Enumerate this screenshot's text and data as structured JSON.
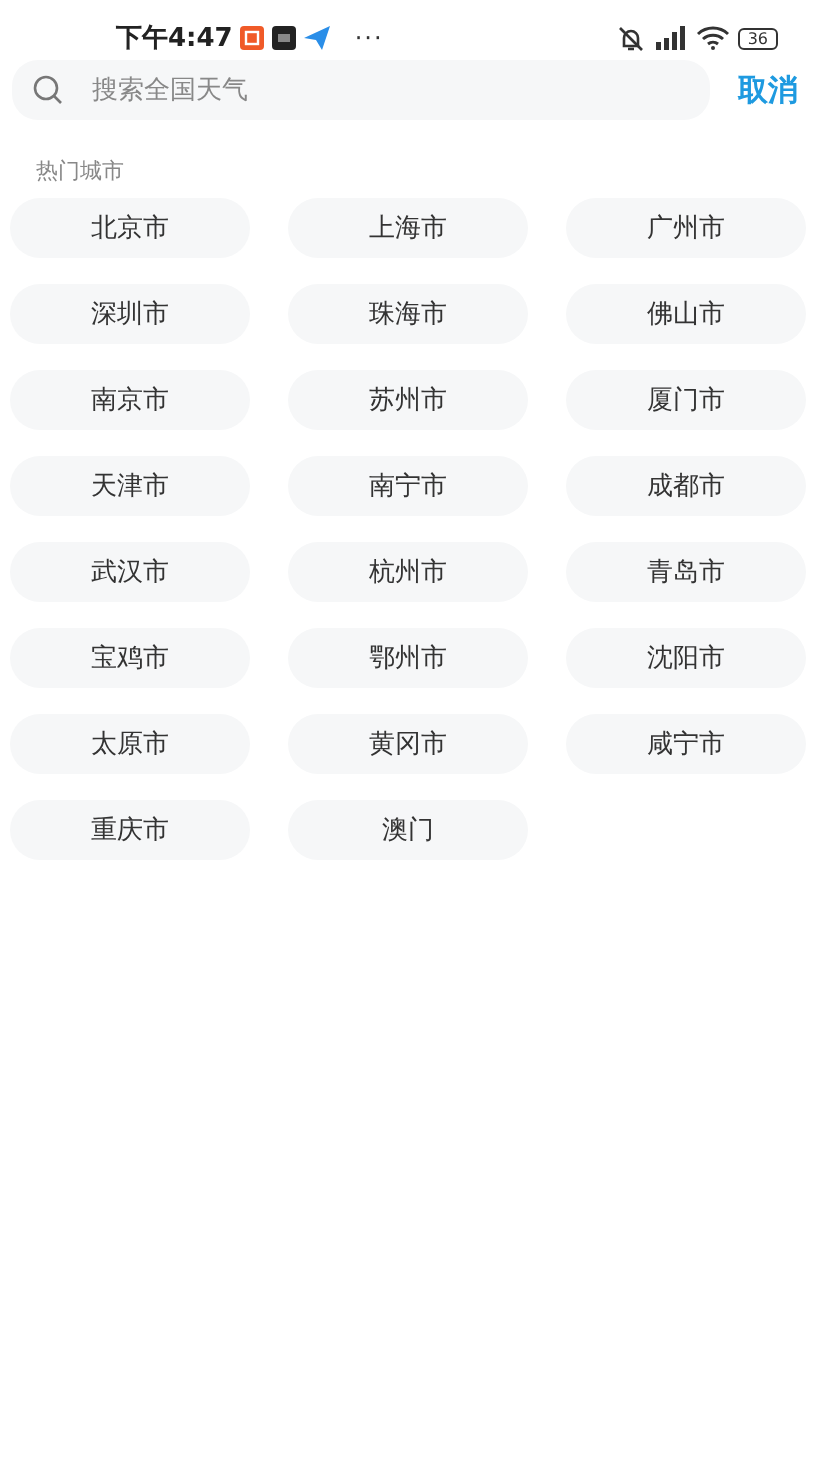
{
  "status_bar": {
    "time": "下午4:47",
    "more": "···",
    "battery": "36"
  },
  "search": {
    "placeholder": "搜索全国天气",
    "cancel": "取消"
  },
  "section_title": "热门城市",
  "cities": [
    "北京市",
    "上海市",
    "广州市",
    "深圳市",
    "珠海市",
    "佛山市",
    "南京市",
    "苏州市",
    "厦门市",
    "天津市",
    "南宁市",
    "成都市",
    "武汉市",
    "杭州市",
    "青岛市",
    "宝鸡市",
    "鄂州市",
    "沈阳市",
    "太原市",
    "黄冈市",
    "咸宁市",
    "重庆市",
    "澳门"
  ]
}
